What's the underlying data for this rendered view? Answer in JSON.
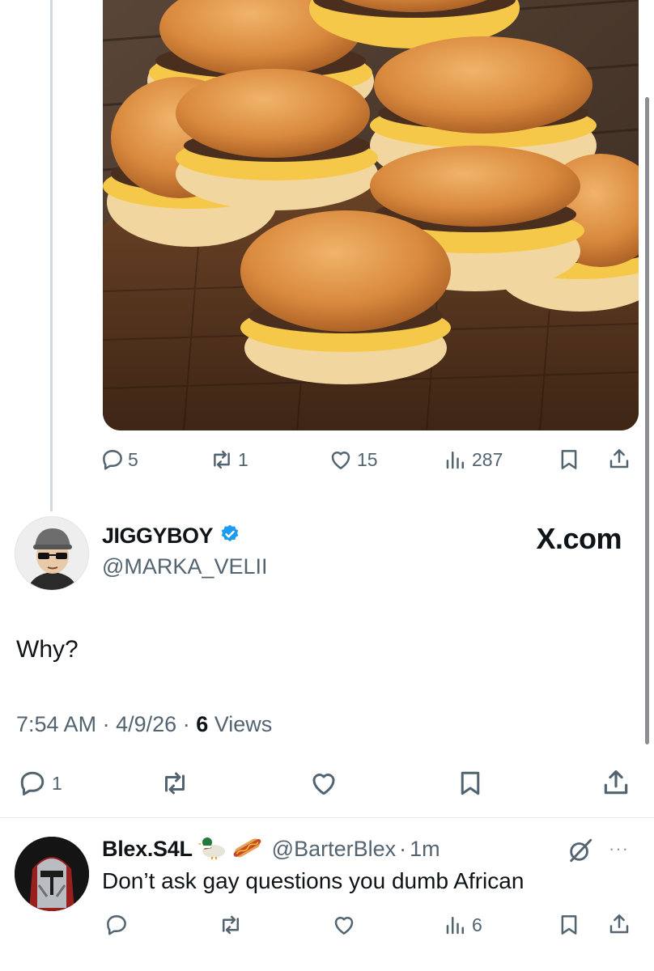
{
  "quoted_tweet": {
    "media_description": "stack of cheeseburgers on wooden board",
    "actions": {
      "replies": "5",
      "reposts": "1",
      "likes": "15",
      "views": "287"
    }
  },
  "main_tweet": {
    "display_name": "JIGGYBOY",
    "handle": "@MARKA_VELII",
    "source_logo_text": "X.com",
    "text": "Why?",
    "time": "7:54 AM",
    "separator": "·",
    "date": "4/9/26",
    "views_count": "6",
    "views_label": "Views",
    "actions": {
      "replies": "1"
    }
  },
  "reply": {
    "display_name": "Blex.S4L",
    "handle": "@BarterBlex",
    "separator": "·",
    "time_ago": "1m",
    "text": "Don’t ask gay questions you dumb African",
    "more": "···",
    "actions": {
      "views": "6"
    }
  },
  "colors": {
    "text_primary": "#0f1419",
    "text_secondary": "#536471",
    "verified_blue": "#1d9bf0",
    "divider": "#e6ecf0",
    "thread_line": "#cfd9de"
  },
  "icons": {
    "reply": "reply-icon",
    "repost": "repost-icon",
    "like": "like-icon",
    "views": "views-icon",
    "bookmark": "bookmark-icon",
    "share": "share-icon",
    "verified": "verified-badge-icon",
    "grok": "grok-icon"
  }
}
